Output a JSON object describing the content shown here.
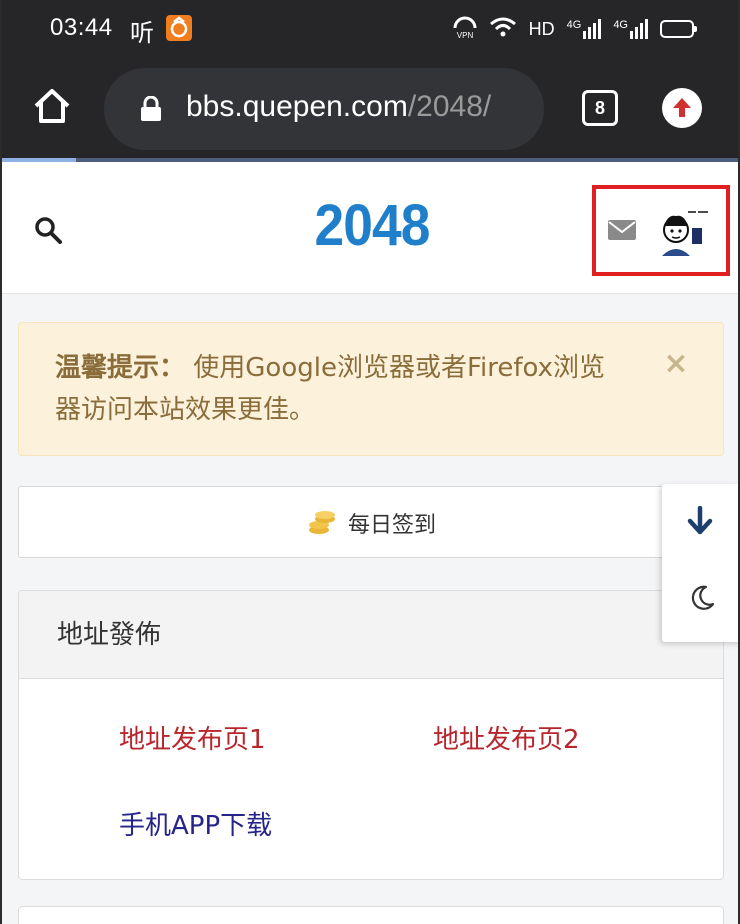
{
  "status_bar": {
    "time": "03:44",
    "listen_label": "听",
    "network": "HD",
    "signal_1": "4G",
    "signal_2": "4G",
    "vpn": "VPN"
  },
  "browser": {
    "url_host": "bbs.quepen.com",
    "url_path": "/2048/",
    "tab_count": "8",
    "load_progress": 0.1
  },
  "site": {
    "logo": "2048",
    "notice": {
      "label": "温馨提示：",
      "message": "使用Google浏览器或者Firefox浏览器访问本站效果更佳。",
      "close": "×"
    },
    "checkin": {
      "label": "每日签到"
    },
    "address_panel": {
      "title": "地址發佈",
      "links": [
        {
          "label": "地址发布页1",
          "color": "#b8262d"
        },
        {
          "label": "地址发布页2",
          "color": "#b8262d"
        },
        {
          "label": "手机APP下载",
          "color": "#26248a"
        }
      ]
    }
  },
  "colors": {
    "brand": "#1f7fcb",
    "highlight": "#e02020",
    "notice_bg": "#fcf2dc"
  }
}
